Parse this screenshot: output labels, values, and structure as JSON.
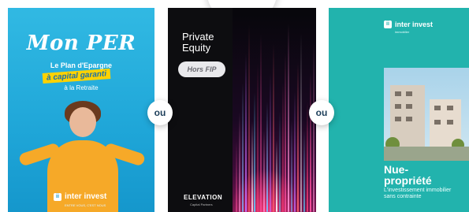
{
  "card_per": {
    "title": "Mon PER",
    "line1": "Le Plan d'Epargne",
    "line2": "à capital garanti",
    "line3": "à la Retraite",
    "brand": "inter invest",
    "brand_icon": "inter-invest-logo-icon",
    "tagline": "ENTRE VOUS, C'EST NOUS",
    "colors": {
      "background": "#1fa6d8",
      "highlight": "#ffd200",
      "sweater": "#f6a928"
    }
  },
  "card_pe": {
    "title_line1": "Private",
    "title_line2": "Equity",
    "pill": "Hors FIP",
    "brand": "ELEVATION",
    "brand_sub": "Capital Partners",
    "colors": {
      "background": "#0a0a0c",
      "accent": "#ff3c78"
    }
  },
  "card_np": {
    "brand": "inter invest",
    "brand_sub": "immobilier",
    "brand_icon": "inter-invest-logo-icon",
    "title_line1": "Nue-",
    "title_line2": "propriété",
    "subtitle": "L'investissement immobilier sans contrainte",
    "colors": {
      "background": "#22b3ad"
    }
  },
  "connectors": {
    "ou_1": "ou",
    "ou_2": "ou"
  }
}
